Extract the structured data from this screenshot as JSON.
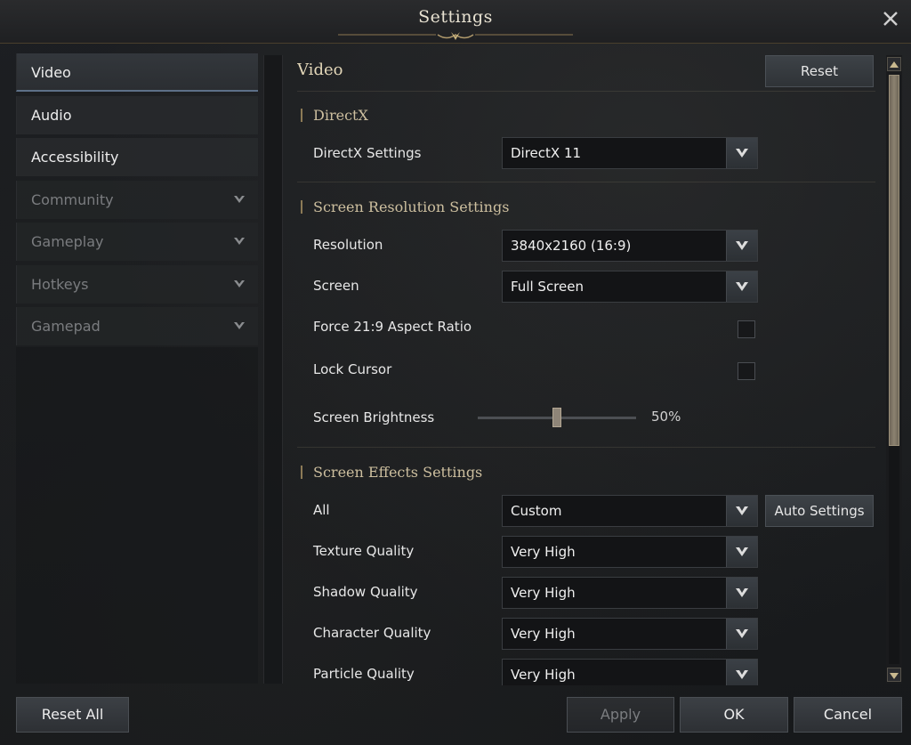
{
  "window": {
    "title": "Settings",
    "close_icon": "close-icon"
  },
  "sidebar": {
    "items": [
      {
        "label": "Video",
        "state": "active"
      },
      {
        "label": "Audio",
        "state": "normal"
      },
      {
        "label": "Accessibility",
        "state": "normal"
      },
      {
        "label": "Community",
        "state": "disabled",
        "expandable": true
      },
      {
        "label": "Gameplay",
        "state": "disabled",
        "expandable": true
      },
      {
        "label": "Hotkeys",
        "state": "disabled",
        "expandable": true
      },
      {
        "label": "Gamepad",
        "state": "disabled",
        "expandable": true
      }
    ]
  },
  "content": {
    "title": "Video",
    "reset_label": "Reset",
    "sections": {
      "directx": {
        "title": "DirectX",
        "directx_settings": {
          "label": "DirectX Settings",
          "value": "DirectX 11"
        }
      },
      "screen_resolution": {
        "title": "Screen Resolution Settings",
        "resolution": {
          "label": "Resolution",
          "value": "3840x2160 (16:9)"
        },
        "screen": {
          "label": "Screen",
          "value": "Full Screen"
        },
        "force_aspect": {
          "label": "Force 21:9 Aspect Ratio",
          "checked": false
        },
        "lock_cursor": {
          "label": "Lock Cursor",
          "checked": false
        },
        "brightness": {
          "label": "Screen Brightness",
          "value": 50,
          "display": "50%"
        }
      },
      "screen_effects": {
        "title": "Screen Effects Settings",
        "all": {
          "label": "All",
          "value": "Custom"
        },
        "auto_settings_label": "Auto Settings",
        "texture": {
          "label": "Texture Quality",
          "value": "Very High"
        },
        "shadow": {
          "label": "Shadow Quality",
          "value": "Very High"
        },
        "character": {
          "label": "Character Quality",
          "value": "Very High"
        },
        "particle": {
          "label": "Particle Quality",
          "value": "Very High"
        }
      }
    }
  },
  "scroll": {
    "position_fraction": 0.0,
    "visible_fraction": 0.63
  },
  "footer": {
    "reset_all_label": "Reset All",
    "apply_label": "Apply",
    "ok_label": "OK",
    "cancel_label": "Cancel"
  },
  "colors": {
    "accent_gold": "#cdbf9f",
    "active_underline": "#5d7088",
    "disabled_text": "#7a7c7f"
  }
}
